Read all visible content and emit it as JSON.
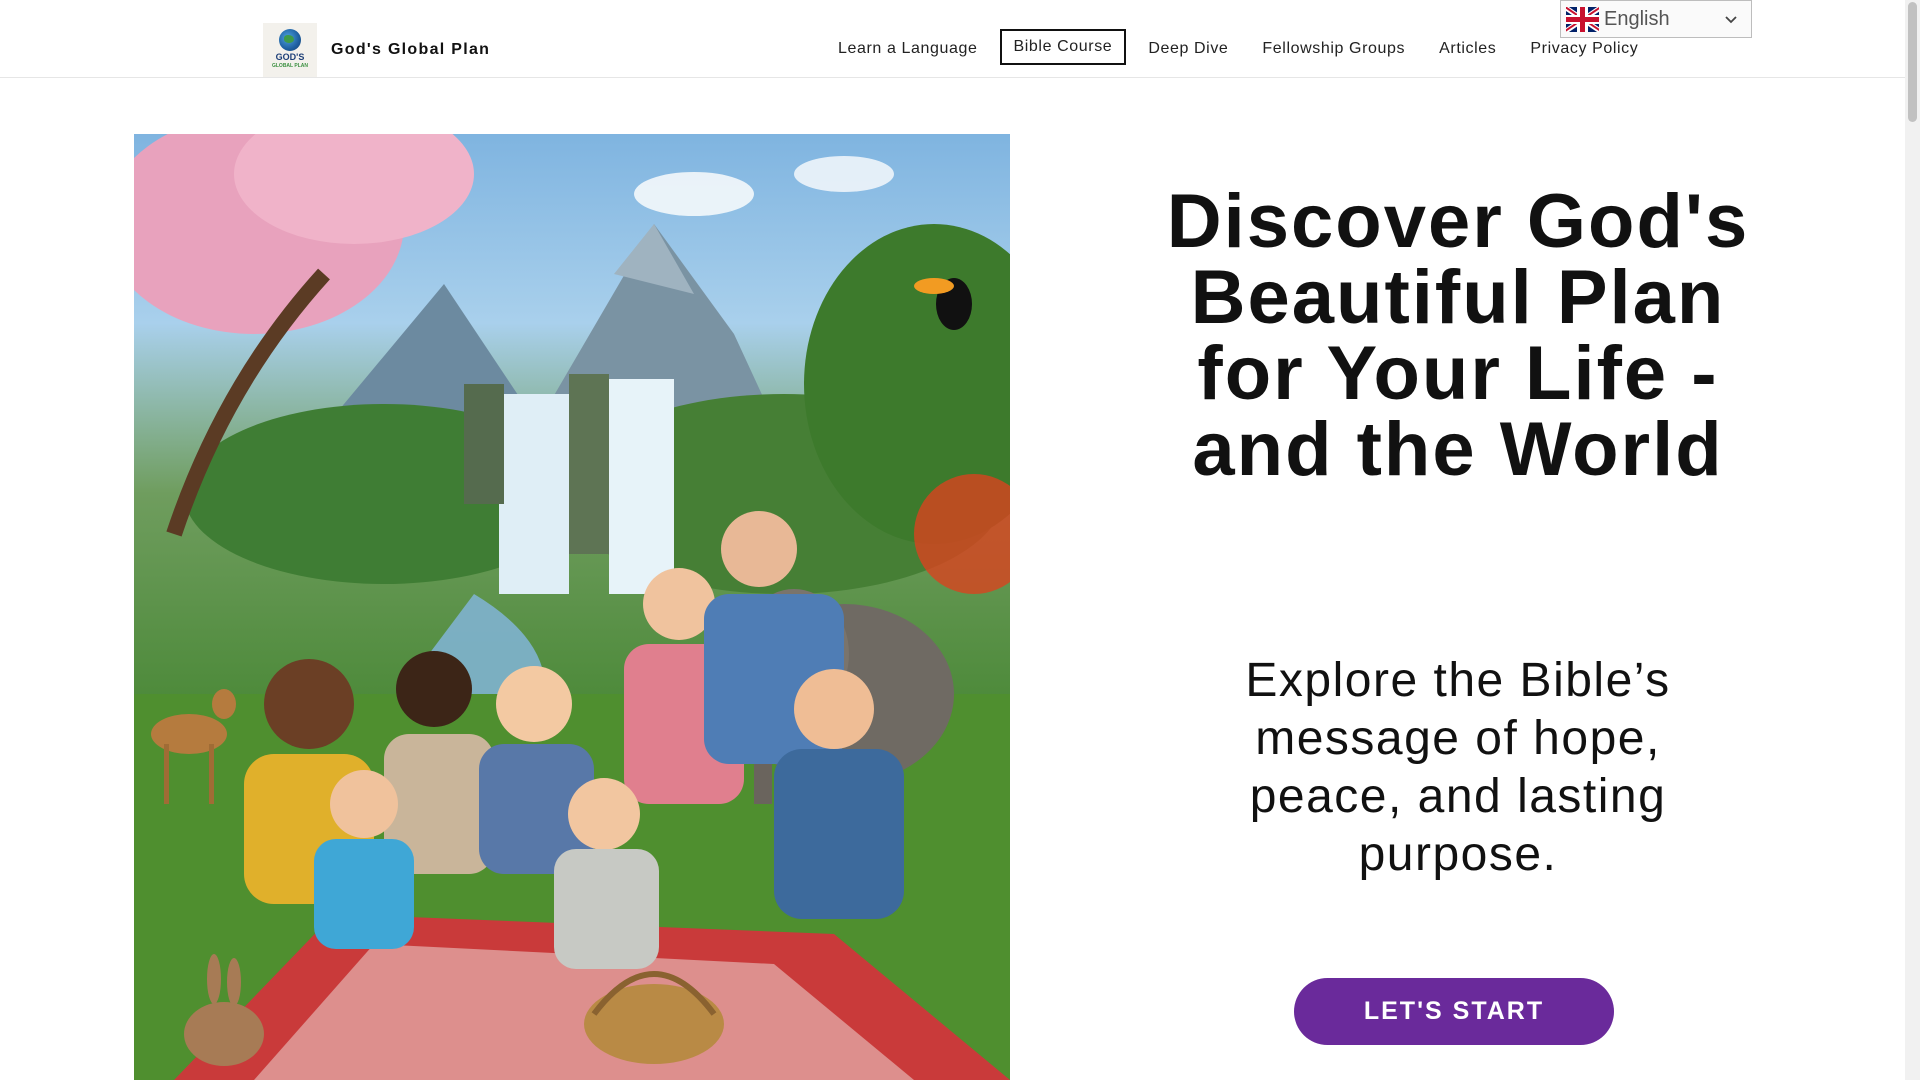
{
  "header": {
    "site_name": "God's Global Plan",
    "logo_text": "GOD'S",
    "logo_subtext": "GLOBAL PLAN",
    "nav": [
      {
        "label": "Learn a Language",
        "active": false
      },
      {
        "label": "Bible Course",
        "active": true
      },
      {
        "label": "Deep Dive",
        "active": false
      },
      {
        "label": "Fellowship Groups",
        "active": false
      },
      {
        "label": "Articles",
        "active": false
      },
      {
        "label": "Privacy Policy",
        "active": false
      }
    ],
    "language": {
      "selected": "English",
      "flag": "uk-flag-icon"
    }
  },
  "hero": {
    "title": "Discover God's Beautiful Plan for Your Life - and the World",
    "subtitle": "Explore the Bible’s message of hope, peace, and lasting purpose.",
    "cta_label": "LET'S START",
    "image_subject": "family picnic by a waterfall with animals in a lush garden"
  },
  "colors": {
    "cta_background": "#6a2a9b",
    "text": "#111111",
    "active_nav_border": "#111111"
  }
}
